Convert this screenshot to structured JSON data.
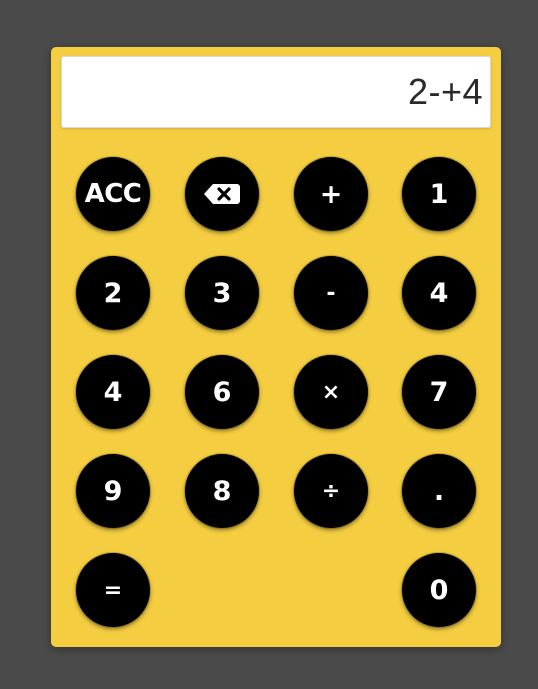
{
  "display": {
    "value": "2-+4"
  },
  "keys": [
    {
      "label": "ACC",
      "name": "acc-button"
    },
    {
      "label": "",
      "name": "backspace-button",
      "icon": "backspace-icon"
    },
    {
      "label": "+",
      "name": "plus-button"
    },
    {
      "label": "1",
      "name": "key-1-button"
    },
    {
      "label": "2",
      "name": "key-2-button"
    },
    {
      "label": "3",
      "name": "key-3-button"
    },
    {
      "label": "-",
      "name": "minus-button"
    },
    {
      "label": "4",
      "name": "key-4-button"
    },
    {
      "label": "4",
      "name": "key-4b-button"
    },
    {
      "label": "6",
      "name": "key-6-button"
    },
    {
      "label": "×",
      "name": "multiply-button"
    },
    {
      "label": "7",
      "name": "key-7-button"
    },
    {
      "label": "9",
      "name": "key-9-button"
    },
    {
      "label": "8",
      "name": "key-8-button"
    },
    {
      "label": "÷",
      "name": "divide-button"
    },
    {
      "label": ".",
      "name": "decimal-button"
    },
    {
      "label": "=",
      "name": "equals-button"
    },
    {
      "label": "0",
      "name": "key-0-button"
    }
  ],
  "colors": {
    "background": "#4a4a4a",
    "calculator_body": "#f4cd40",
    "key_fill": "#000000",
    "key_text": "#ffffff",
    "display_bg": "#ffffff",
    "display_text": "#2a2a2a"
  }
}
